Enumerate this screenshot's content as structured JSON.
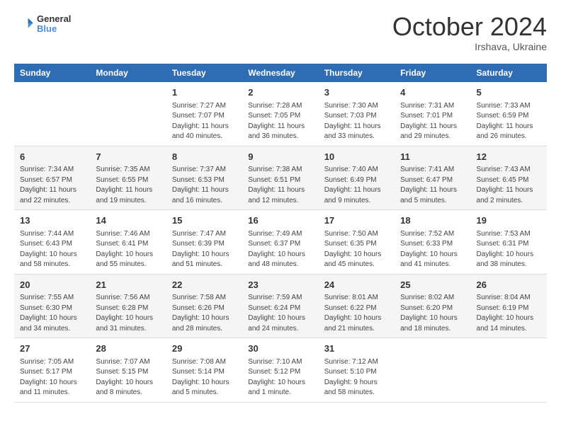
{
  "header": {
    "logo_line1": "General",
    "logo_line2": "Blue",
    "month": "October 2024",
    "location": "Irshava, Ukraine"
  },
  "weekdays": [
    "Sunday",
    "Monday",
    "Tuesday",
    "Wednesday",
    "Thursday",
    "Friday",
    "Saturday"
  ],
  "weeks": [
    [
      {
        "day": "",
        "info": ""
      },
      {
        "day": "",
        "info": ""
      },
      {
        "day": "1",
        "info": "Sunrise: 7:27 AM\nSunset: 7:07 PM\nDaylight: 11 hours and 40 minutes."
      },
      {
        "day": "2",
        "info": "Sunrise: 7:28 AM\nSunset: 7:05 PM\nDaylight: 11 hours and 36 minutes."
      },
      {
        "day": "3",
        "info": "Sunrise: 7:30 AM\nSunset: 7:03 PM\nDaylight: 11 hours and 33 minutes."
      },
      {
        "day": "4",
        "info": "Sunrise: 7:31 AM\nSunset: 7:01 PM\nDaylight: 11 hours and 29 minutes."
      },
      {
        "day": "5",
        "info": "Sunrise: 7:33 AM\nSunset: 6:59 PM\nDaylight: 11 hours and 26 minutes."
      }
    ],
    [
      {
        "day": "6",
        "info": "Sunrise: 7:34 AM\nSunset: 6:57 PM\nDaylight: 11 hours and 22 minutes."
      },
      {
        "day": "7",
        "info": "Sunrise: 7:35 AM\nSunset: 6:55 PM\nDaylight: 11 hours and 19 minutes."
      },
      {
        "day": "8",
        "info": "Sunrise: 7:37 AM\nSunset: 6:53 PM\nDaylight: 11 hours and 16 minutes."
      },
      {
        "day": "9",
        "info": "Sunrise: 7:38 AM\nSunset: 6:51 PM\nDaylight: 11 hours and 12 minutes."
      },
      {
        "day": "10",
        "info": "Sunrise: 7:40 AM\nSunset: 6:49 PM\nDaylight: 11 hours and 9 minutes."
      },
      {
        "day": "11",
        "info": "Sunrise: 7:41 AM\nSunset: 6:47 PM\nDaylight: 11 hours and 5 minutes."
      },
      {
        "day": "12",
        "info": "Sunrise: 7:43 AM\nSunset: 6:45 PM\nDaylight: 11 hours and 2 minutes."
      }
    ],
    [
      {
        "day": "13",
        "info": "Sunrise: 7:44 AM\nSunset: 6:43 PM\nDaylight: 10 hours and 58 minutes."
      },
      {
        "day": "14",
        "info": "Sunrise: 7:46 AM\nSunset: 6:41 PM\nDaylight: 10 hours and 55 minutes."
      },
      {
        "day": "15",
        "info": "Sunrise: 7:47 AM\nSunset: 6:39 PM\nDaylight: 10 hours and 51 minutes."
      },
      {
        "day": "16",
        "info": "Sunrise: 7:49 AM\nSunset: 6:37 PM\nDaylight: 10 hours and 48 minutes."
      },
      {
        "day": "17",
        "info": "Sunrise: 7:50 AM\nSunset: 6:35 PM\nDaylight: 10 hours and 45 minutes."
      },
      {
        "day": "18",
        "info": "Sunrise: 7:52 AM\nSunset: 6:33 PM\nDaylight: 10 hours and 41 minutes."
      },
      {
        "day": "19",
        "info": "Sunrise: 7:53 AM\nSunset: 6:31 PM\nDaylight: 10 hours and 38 minutes."
      }
    ],
    [
      {
        "day": "20",
        "info": "Sunrise: 7:55 AM\nSunset: 6:30 PM\nDaylight: 10 hours and 34 minutes."
      },
      {
        "day": "21",
        "info": "Sunrise: 7:56 AM\nSunset: 6:28 PM\nDaylight: 10 hours and 31 minutes."
      },
      {
        "day": "22",
        "info": "Sunrise: 7:58 AM\nSunset: 6:26 PM\nDaylight: 10 hours and 28 minutes."
      },
      {
        "day": "23",
        "info": "Sunrise: 7:59 AM\nSunset: 6:24 PM\nDaylight: 10 hours and 24 minutes."
      },
      {
        "day": "24",
        "info": "Sunrise: 8:01 AM\nSunset: 6:22 PM\nDaylight: 10 hours and 21 minutes."
      },
      {
        "day": "25",
        "info": "Sunrise: 8:02 AM\nSunset: 6:20 PM\nDaylight: 10 hours and 18 minutes."
      },
      {
        "day": "26",
        "info": "Sunrise: 8:04 AM\nSunset: 6:19 PM\nDaylight: 10 hours and 14 minutes."
      }
    ],
    [
      {
        "day": "27",
        "info": "Sunrise: 7:05 AM\nSunset: 5:17 PM\nDaylight: 10 hours and 11 minutes."
      },
      {
        "day": "28",
        "info": "Sunrise: 7:07 AM\nSunset: 5:15 PM\nDaylight: 10 hours and 8 minutes."
      },
      {
        "day": "29",
        "info": "Sunrise: 7:08 AM\nSunset: 5:14 PM\nDaylight: 10 hours and 5 minutes."
      },
      {
        "day": "30",
        "info": "Sunrise: 7:10 AM\nSunset: 5:12 PM\nDaylight: 10 hours and 1 minute."
      },
      {
        "day": "31",
        "info": "Sunrise: 7:12 AM\nSunset: 5:10 PM\nDaylight: 9 hours and 58 minutes."
      },
      {
        "day": "",
        "info": ""
      },
      {
        "day": "",
        "info": ""
      }
    ]
  ]
}
